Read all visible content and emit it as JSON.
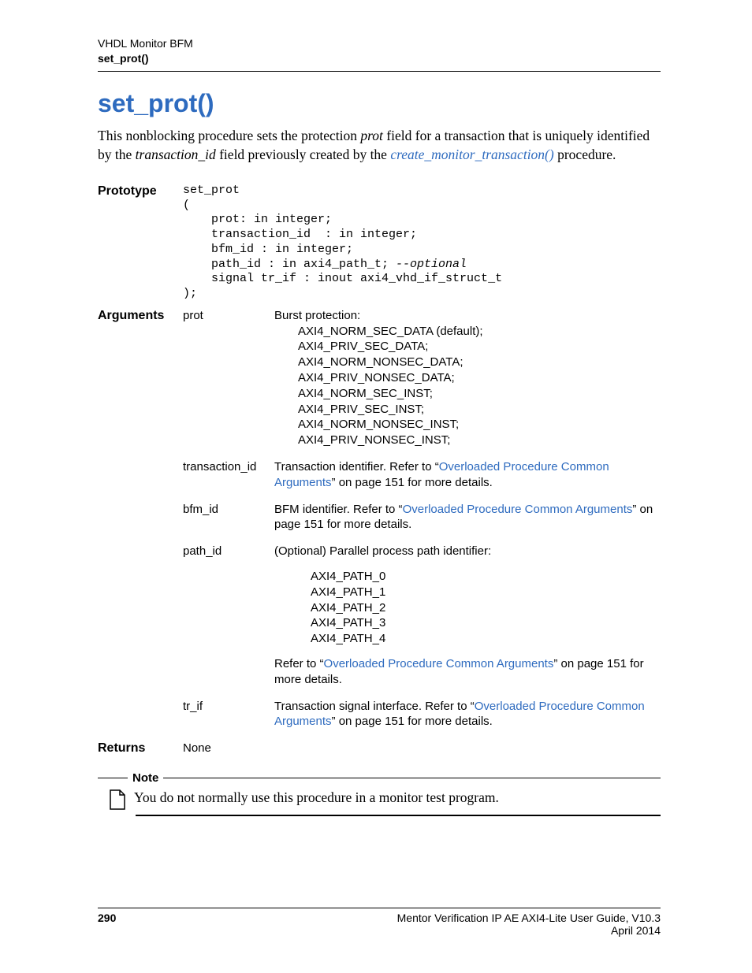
{
  "header": {
    "breadcrumb": "VHDL Monitor BFM",
    "section": "set_prot()"
  },
  "title": "set_prot()",
  "intro": {
    "p1a": "This nonblocking procedure sets the protection ",
    "p1b": "prot",
    "p1c": " field for a transaction that is uniquely identified by the ",
    "p1d": "transaction_id",
    "p1e": " field previously created by the ",
    "p1link": "create_monitor_transaction()",
    "p1f": " procedure."
  },
  "labels": {
    "prototype": "Prototype",
    "arguments": "Arguments",
    "returns": "Returns",
    "note": "Note"
  },
  "prototype": {
    "l1": "set_prot",
    "l2": "(",
    "l3": "    prot: in integer;",
    "l4": "    transaction_id  : in integer;",
    "l5": "    bfm_id : in integer;",
    "l6a": "    path_id : in axi4_path_t; ",
    "l6b": "--optional",
    "l7": "    signal tr_if : inout axi4_vhd_if_struct_t",
    "l8": ");"
  },
  "args": {
    "prot": {
      "name": "prot",
      "desc_lead": "Burst protection:",
      "v1": "AXI4_NORM_SEC_DATA (default);",
      "v2": "AXI4_PRIV_SEC_DATA;",
      "v3": "AXI4_NORM_NONSEC_DATA;",
      "v4": "AXI4_PRIV_NONSEC_DATA;",
      "v5": "AXI4_NORM_SEC_INST;",
      "v6": "AXI4_PRIV_SEC_INST;",
      "v7": "AXI4_NORM_NONSEC_INST;",
      "v8": "AXI4_PRIV_NONSEC_INST;"
    },
    "transaction_id": {
      "name": "transaction_id",
      "d1": "Transaction identifier. Refer to “",
      "link": "Overloaded Procedure Common Arguments",
      "d2": "” on page 151 for more details."
    },
    "bfm_id": {
      "name": "bfm_id",
      "d1": "BFM identifier. Refer to “",
      "link": "Overloaded Procedure Common Arguments",
      "d2": "” on page 151 for more details."
    },
    "path_id": {
      "name": "path_id",
      "d1": "(Optional) Parallel process path identifier:",
      "p0": "AXI4_PATH_0",
      "p1": "AXI4_PATH_1",
      "p2": "AXI4_PATH_2",
      "p3": "AXI4_PATH_3",
      "p4": "AXI4_PATH_4",
      "d2a": "Refer to “",
      "link": "Overloaded Procedure Common Arguments",
      "d2b": "” on page 151 for more details."
    },
    "tr_if": {
      "name": "tr_if",
      "d1": "Transaction signal interface. Refer to “",
      "link": "Overloaded Procedure Common Arguments",
      "d2": "” on page 151 for more details."
    }
  },
  "returns": "None",
  "note_text": "You do not normally use this procedure in a monitor test program.",
  "footer": {
    "page": "290",
    "title": "Mentor Verification IP AE AXI4-Lite User Guide, V10.3",
    "date": "April 2014"
  }
}
